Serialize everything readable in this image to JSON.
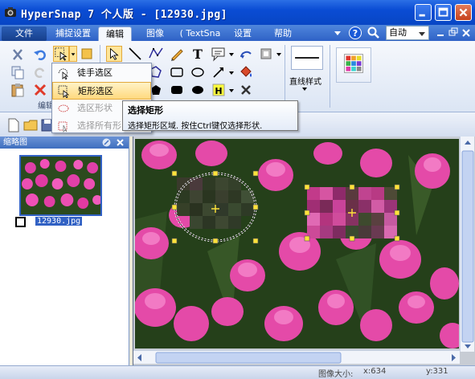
{
  "window": {
    "title": "HyperSnap 7 个人版 - [12930.jpg]",
    "controls": [
      "minimize",
      "maximize",
      "close"
    ]
  },
  "menu": {
    "tabs": [
      {
        "label": "文件",
        "name": "file"
      },
      {
        "label": "捕捉设置",
        "name": "capture-settings"
      },
      {
        "label": "编辑",
        "name": "edit",
        "active": true
      },
      {
        "label": "图像",
        "name": "image"
      },
      {
        "label": "( TextSna",
        "name": "textsnap"
      },
      {
        "label": "设置",
        "name": "settings"
      },
      {
        "label": "帮助",
        "name": "help"
      }
    ],
    "zoom_value": "自动"
  },
  "ribbon": {
    "group_edit_label": "编辑",
    "style_button_label": "直线样式",
    "colors": {
      "accent_selected": "#ffe69a",
      "highlight_border": "#e2a93c"
    }
  },
  "dropdown": {
    "items": [
      {
        "label": "徒手选区",
        "icon": "freehand-select-icon",
        "state": "normal"
      },
      {
        "label": "矩形选区",
        "icon": "rect-select-icon",
        "state": "highlighted"
      },
      {
        "label": "选区形状",
        "icon": "select-shape-icon",
        "state": "disabled"
      },
      {
        "label": "选择所有形",
        "icon": "select-all-shapes-icon",
        "state": "disabled"
      }
    ]
  },
  "tooltip": {
    "title": "选择矩形",
    "body": "选择矩形区域. 按住Ctrl键仅选择形状."
  },
  "thumbnails": {
    "header": "缩略图",
    "items": [
      {
        "filename": "12930.jpg"
      }
    ]
  },
  "status": {
    "image_size_label": "图像大小:",
    "x_label": "x:634",
    "y_label": "y:331"
  }
}
